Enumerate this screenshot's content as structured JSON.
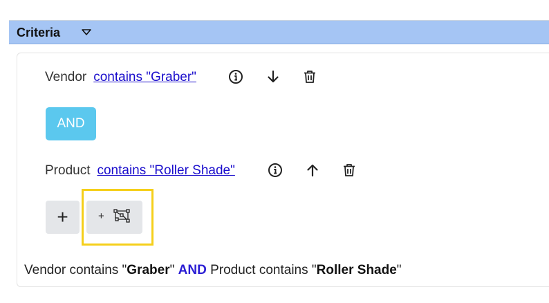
{
  "header": {
    "title": "Criteria",
    "chevron_icon": "chevron-down-icon",
    "background": "#a5c5f4"
  },
  "criteria": [
    {
      "field": "Vendor",
      "condition": "contains \"Graber\"",
      "icons": [
        "info-icon",
        "arrow-down-icon",
        "trash-icon"
      ]
    },
    {
      "field": "Product",
      "condition": "contains \"Roller Shade\"",
      "icons": [
        "info-icon",
        "arrow-up-icon",
        "trash-icon"
      ]
    }
  ],
  "operator": {
    "label": "AND",
    "color": "#5bc8ee"
  },
  "actions": {
    "add_label": "+",
    "add_group_prefix": "+",
    "add_group_icon": "group-nodes-icon",
    "highlight_color": "#f5cf1a"
  },
  "summary": {
    "part1": "Vendor contains \"",
    "value1": "Graber",
    "part2": "\" ",
    "operator": "AND",
    "part3": " Product contains \"",
    "value2": "Roller Shade",
    "part4": "\""
  },
  "colors": {
    "link": "#1a0dcc",
    "operator_text": "#2b1ed4"
  }
}
